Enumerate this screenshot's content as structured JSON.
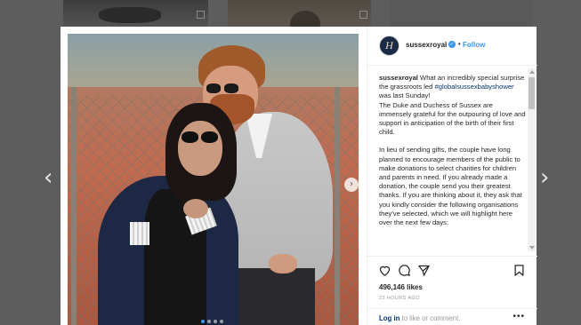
{
  "post": {
    "username": "sussexroyal",
    "avatar_glyph": "H",
    "separator": "•",
    "follow_label": "Follow",
    "caption_user": "sussexroyal",
    "caption_line1": "What an incredibly special surprise the grassroots led",
    "hashtag": "#globalsussexbabyshower",
    "caption_line1_end": "was last Sunday!",
    "caption_line2": "The Duke and Duchess of Sussex are immensely grateful for the outpouring of love and support in anticipation of the birth of their first child.",
    "caption_para2": "In lieu of sending gifts, the couple have long planned to encourage members of the public to make donations to select charities for children and parents in need. If you already made a donation, the couple send you their greatest thanks. If you are thinking about it, they ask that you kindly consider the following organisations they've selected, which we will highlight here over the next few days:",
    "likes": "496,146 likes",
    "time": "22 HOURS AGO",
    "login_link": "Log in",
    "login_rest": "to like or comment.",
    "more": "•••",
    "carousel_next": "›"
  },
  "navigation": {
    "prev": "‹",
    "next": "›"
  },
  "icons": [
    "heart-icon",
    "comment-icon",
    "share-icon",
    "bookmark-icon",
    "verified-icon"
  ],
  "colors": {
    "link_blue": "#3897f0",
    "hashtag": "#003569",
    "overlay": "#5d5d5d"
  }
}
